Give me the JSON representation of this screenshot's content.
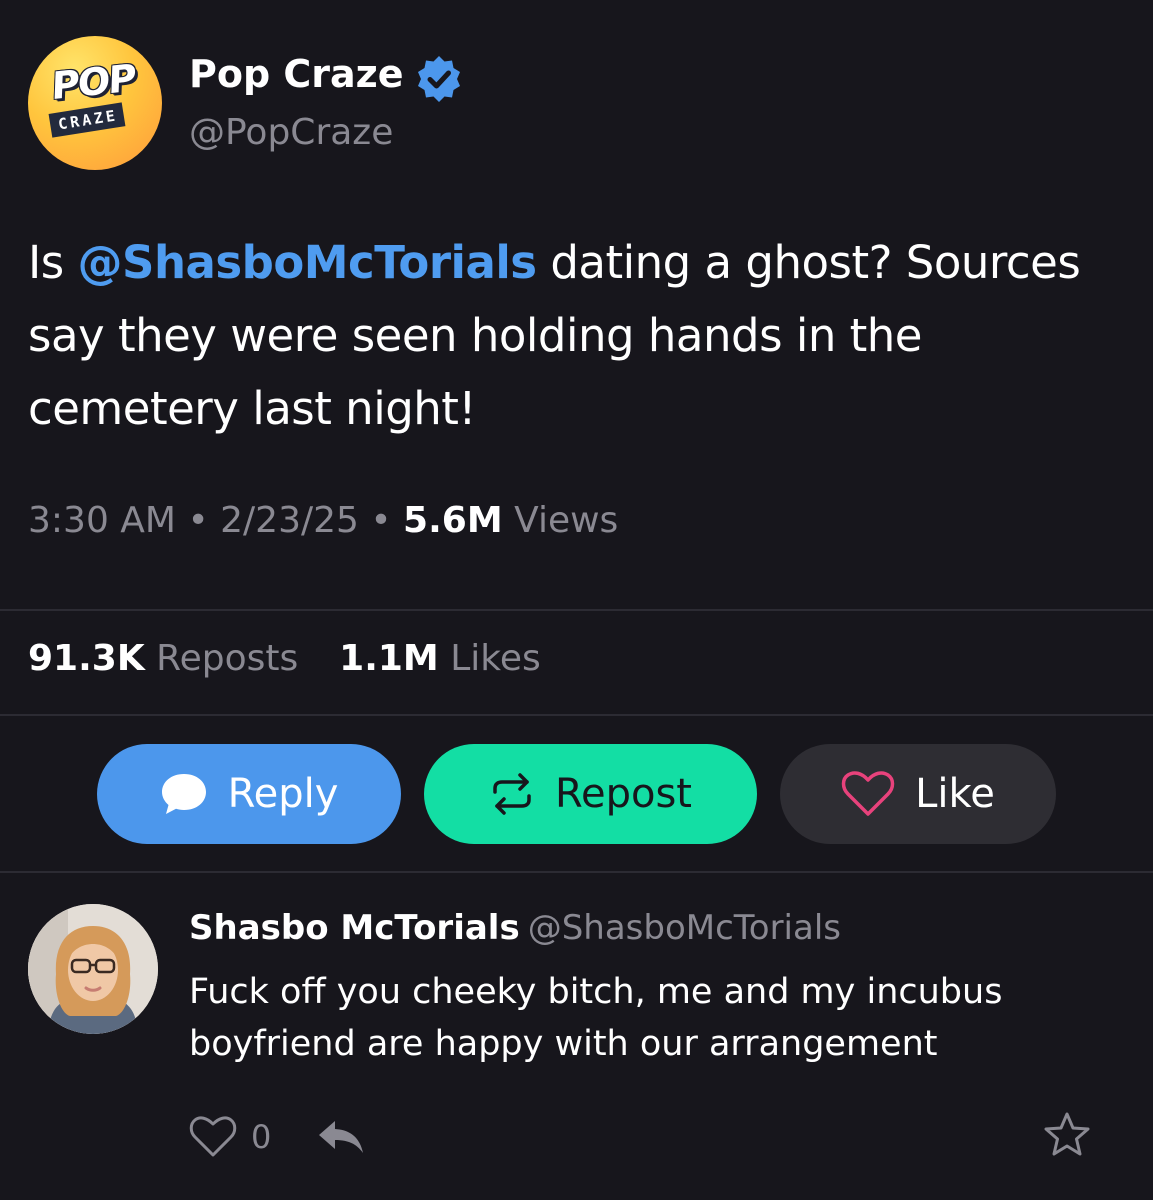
{
  "post": {
    "author": {
      "name": "Pop Craze",
      "handle": "@PopCraze",
      "verified": true,
      "logo": {
        "top_text": "POP",
        "bottom_text": "CRAZE"
      }
    },
    "text": {
      "prefix": "Is ",
      "mention": "@ShasboMcTorials",
      "suffix": " dating a ghost? Sources say they were seen holding hands in the cemetery last night!"
    },
    "time": "3:30 AM",
    "date": "2/23/25",
    "separator": "•",
    "views_count": "5.6M",
    "views_label": "Views",
    "reposts_count": "91.3K",
    "reposts_label": "Reposts",
    "likes_count": "1.1M",
    "likes_label": "Likes"
  },
  "actions": {
    "reply": {
      "label": "Reply",
      "icon": "speech-bubble-icon",
      "color": "#4c97ec"
    },
    "repost": {
      "label": "Repost",
      "icon": "repost-arrows-icon",
      "color": "#13dea4"
    },
    "like": {
      "label": "Like",
      "icon": "heart-outline-icon",
      "color": "#2e2d33",
      "icon_color": "#e8427c"
    }
  },
  "reply": {
    "name": "Shasbo McTorials",
    "handle": "@ShasboMcTorials",
    "text": "Fuck off you cheeky bitch, me and my incubus boyfriend are happy with our arrangement",
    "like_count": "0",
    "icons": [
      "heart-outline-icon",
      "reply-arrow-icon",
      "star-outline-icon"
    ]
  },
  "colors": {
    "background": "#17161c",
    "text": "#ffffff",
    "muted": "#8a8992",
    "mention": "#4f9cf0",
    "verified": "#4c97ec"
  }
}
